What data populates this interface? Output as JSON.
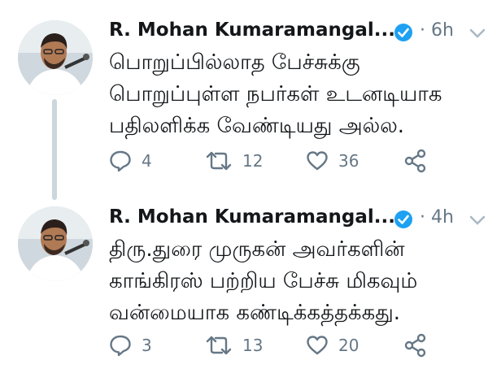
{
  "tweets": [
    {
      "author": "R. Mohan Kumaramangal...",
      "time": "6h",
      "separator": "·",
      "lines": [
        "பொறுப்பில்லாத பேச்சுக்கு",
        "பொறுப்புள்ள நபர்கள் உடனடியாக",
        "பதிலளிக்க வேண்டியது அல்ல."
      ],
      "replies": "4",
      "retweets": "12",
      "likes": "36"
    },
    {
      "author": "R. Mohan Kumaramangal...",
      "time": "4h",
      "separator": "·",
      "lines": [
        "திரு.துரை முருகன் அவர்களின்",
        "காங்கிரஸ் பற்றிய பேச்சு மிகவும்",
        "வன்மையாக கண்டிக்கத்தக்கது."
      ],
      "replies": "3",
      "retweets": "13",
      "likes": "20"
    }
  ],
  "icons": {
    "reply": "reply-icon",
    "retweet": "retweet-icon",
    "like": "heart-icon",
    "share": "share-icon",
    "verified": "verified-badge-icon",
    "more": "chevron-down-icon"
  },
  "colors": {
    "verified": "#1da1f2",
    "muted": "#657786",
    "text": "#14171a"
  }
}
